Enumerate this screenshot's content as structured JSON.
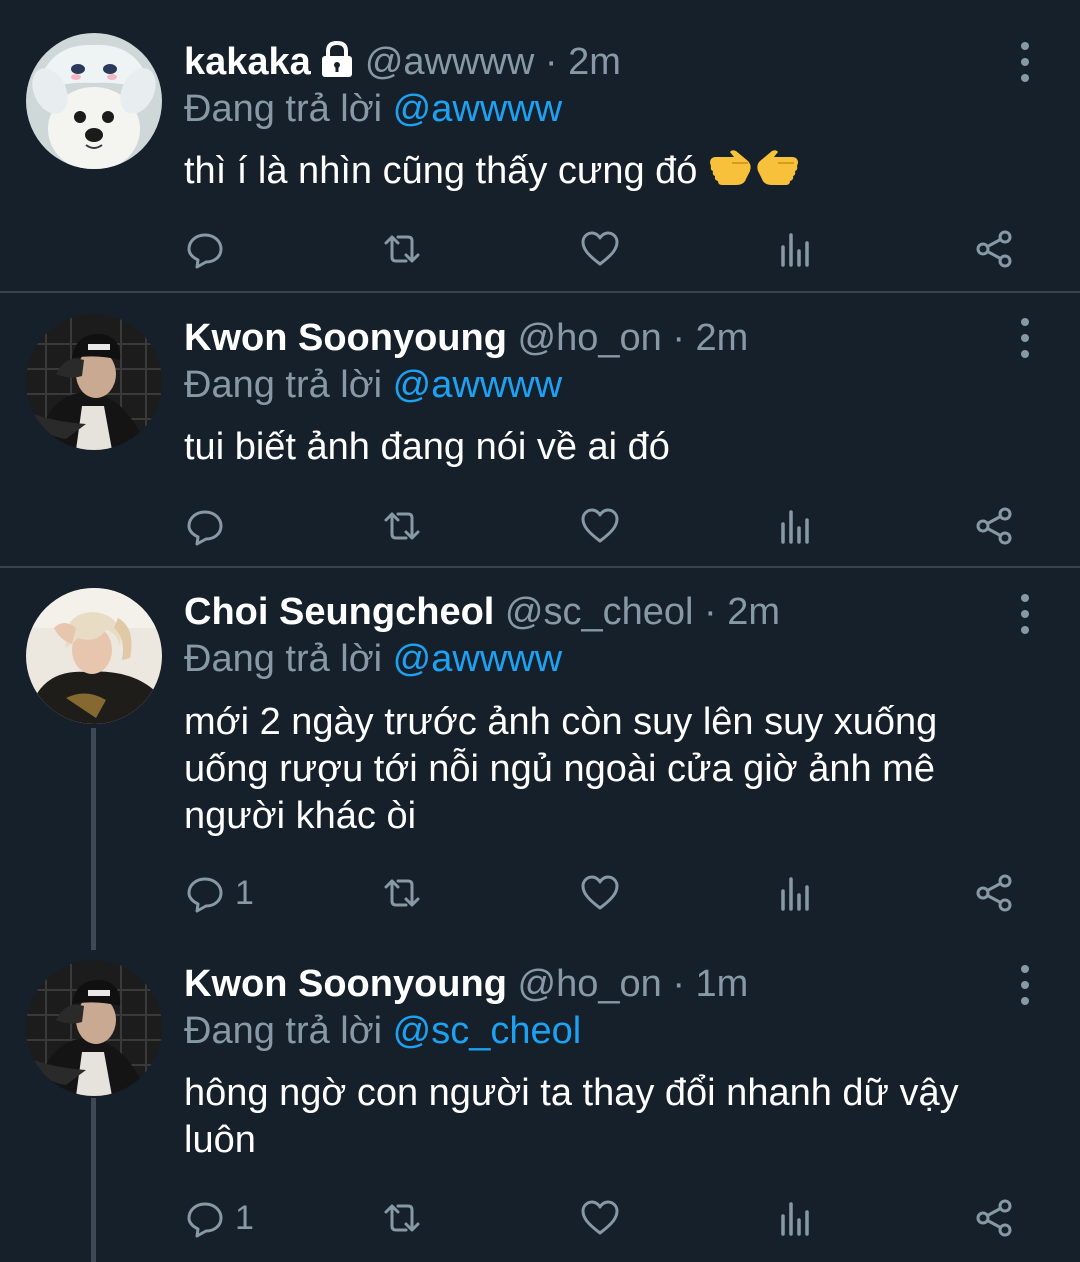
{
  "colors": {
    "background": "#15202b",
    "divider": "#38444d",
    "muted_text": "#8899a6",
    "link": "#1da1f2",
    "text": "#ffffff"
  },
  "tweets": [
    {
      "name": "kakaka",
      "protected": true,
      "handle": "@awwww",
      "separator": "·",
      "time": "2m",
      "reply_prefix": "Đang trả lời",
      "reply_to": "@awwww",
      "text": "thì í là nhìn cũng thấy cưng đó",
      "emoji": [
        "backhand-index-pointing-left",
        "backhand-index-pointing-right"
      ],
      "avatar": "dog-avatar",
      "reply_count": ""
    },
    {
      "name": "Kwon Soonyoung",
      "handle": "@ho_on",
      "separator": "·",
      "time": "2m",
      "reply_prefix": "Đang trả lời",
      "reply_to": "@awwww",
      "text": "tui biết ảnh đang nói về ai đó",
      "avatar": "person-cap-avatar",
      "reply_count": ""
    },
    {
      "name": "Choi Seungcheol",
      "handle": "@sc_cheol",
      "separator": "·",
      "time": "2m",
      "reply_prefix": "Đang trả lời",
      "reply_to": "@awwww",
      "text_lines": [
        "mới 2 ngày trước ảnh còn suy lên suy xuống",
        "uống rượu tới nỗi ngủ ngoài cửa giờ ảnh mê",
        "người khác òi"
      ],
      "avatar": "person-blond-avatar",
      "reply_count": "1"
    },
    {
      "name": "Kwon Soonyoung",
      "handle": "@ho_on",
      "separator": "·",
      "time": "1m",
      "reply_prefix": "Đang trả lời",
      "reply_to": "@sc_cheol",
      "text_lines": [
        "hông ngờ con người ta thay đổi nhanh dữ vậy",
        "luôn"
      ],
      "avatar": "person-cap-avatar",
      "reply_count": "1"
    }
  ],
  "action_icons": [
    "reply-icon",
    "retweet-icon",
    "like-icon",
    "analytics-icon",
    "share-icon"
  ]
}
